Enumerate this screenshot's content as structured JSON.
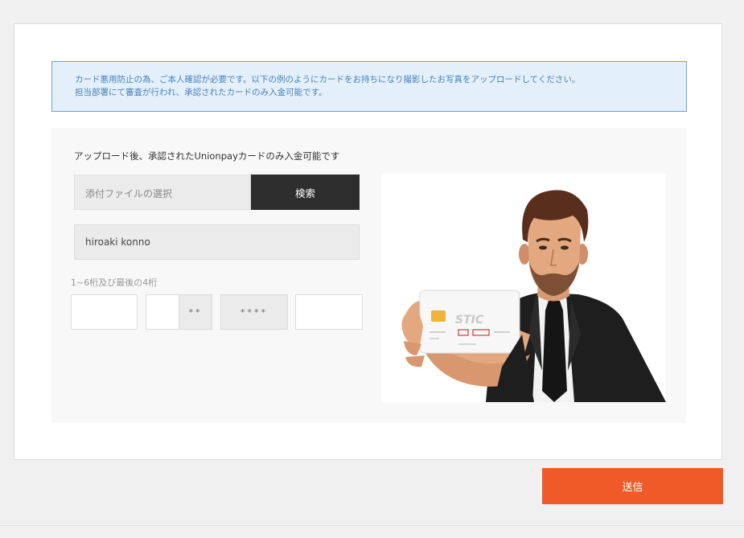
{
  "notice": {
    "line1": "カード悪用防止の為、ご本人確認が必要です。以下の例のようにカードをお持ちになり撮影したお写真をアップロードしてください。",
    "line2": "担当部署にて審査が行われ、承認されたカードのみ入金可能です。"
  },
  "upload": {
    "title": "アップロード後、承認されたUnionpayカードのみ入金可能です",
    "file_placeholder": "添付ファイルの選択",
    "browse_label": "検索"
  },
  "cardholder": {
    "name": "hiroaki konno"
  },
  "card_digits": {
    "label": "1~6桁及び最後の4桁",
    "masked_a": "**",
    "masked_b": "****"
  },
  "illustration": {
    "card_brand_text": "STIC",
    "icon": "man-holding-card-illustration"
  },
  "actions": {
    "submit_label": "送信"
  },
  "colors": {
    "submit": "#f05a28",
    "browse": "#2e2e2e",
    "notice_bg": "#e3f0fb",
    "notice_border": "#6fa5cf"
  }
}
